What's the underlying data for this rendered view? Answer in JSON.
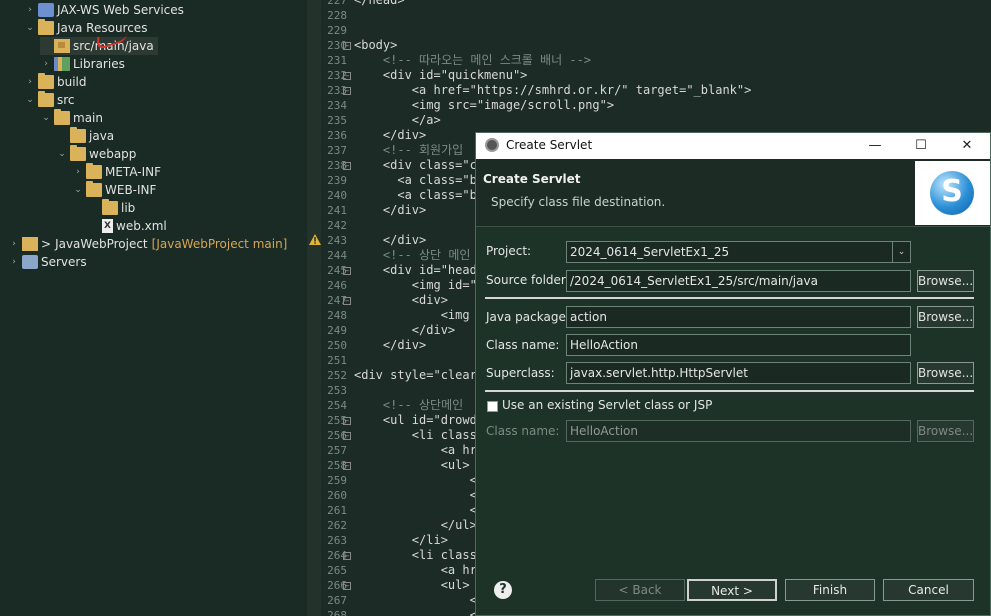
{
  "explorer": {
    "items": [
      {
        "label": "JAX-WS Web Services",
        "icon": "web-services-icon"
      },
      {
        "label": "Java Resources",
        "icon": "java-resources-icon"
      },
      {
        "label": "src/main/java",
        "icon": "source-folder-icon"
      },
      {
        "label": "Libraries",
        "icon": "libraries-icon"
      },
      {
        "label": "build",
        "icon": "folder-icon"
      },
      {
        "label": "src",
        "icon": "folder-icon"
      },
      {
        "label": "main",
        "icon": "folder-icon"
      },
      {
        "label": "java",
        "icon": "folder-icon"
      },
      {
        "label": "webapp",
        "icon": "folder-icon"
      },
      {
        "label": "META-INF",
        "icon": "folder-icon"
      },
      {
        "label": "WEB-INF",
        "icon": "folder-icon"
      },
      {
        "label": "lib",
        "icon": "folder-icon"
      },
      {
        "label": "web.xml",
        "icon": "xml-file-icon"
      },
      {
        "label": "JavaWebProject",
        "icon": "project-icon",
        "prefix": ">",
        "decoration": "[JavaWebProject main]"
      },
      {
        "label": "Servers",
        "icon": "servers-icon"
      }
    ]
  },
  "editor": {
    "lines": [
      {
        "num": "227",
        "text": "</head>"
      },
      {
        "num": "228",
        "text": ""
      },
      {
        "num": "229",
        "text": ""
      },
      {
        "num": "230",
        "text": "<body>"
      },
      {
        "num": "231",
        "text": "    <!-- 따라오는 메인 스크롤 배너 -->"
      },
      {
        "num": "232",
        "text": "    <div id=\"quickmenu\">"
      },
      {
        "num": "233",
        "text": "        <a href=\"https://smhrd.or.kr/\" target=\"_blank\">"
      },
      {
        "num": "234",
        "text": "        <img src=\"image/scroll.png\">"
      },
      {
        "num": "235",
        "text": "        </a>"
      },
      {
        "num": "236",
        "text": "    </div>"
      },
      {
        "num": "237",
        "text": "    <!-- 회원가입"
      },
      {
        "num": "238",
        "text": "    <div class=\"co"
      },
      {
        "num": "239",
        "text": "      <a class=\"b"
      },
      {
        "num": "240",
        "text": "      <a class=\"b"
      },
      {
        "num": "241",
        "text": "    </div>"
      },
      {
        "num": "242",
        "text": ""
      },
      {
        "num": "243",
        "text": "    </div>"
      },
      {
        "num": "244",
        "text": "    <!-- 상단 메인"
      },
      {
        "num": "245",
        "text": "    <div id=\"head"
      },
      {
        "num": "246",
        "text": "        <img id=\""
      },
      {
        "num": "247",
        "text": "        <div>"
      },
      {
        "num": "248",
        "text": "            <img i"
      },
      {
        "num": "249",
        "text": "        </div>"
      },
      {
        "num": "250",
        "text": "    </div>"
      },
      {
        "num": "251",
        "text": ""
      },
      {
        "num": "252",
        "text": "<div style=\"clear"
      },
      {
        "num": "253",
        "text": ""
      },
      {
        "num": "254",
        "text": "    <!-- 상단메인"
      },
      {
        "num": "255",
        "text": "    <ul id=\"drowdo"
      },
      {
        "num": "256",
        "text": "        <li class="
      },
      {
        "num": "257",
        "text": "            <a hre"
      },
      {
        "num": "258",
        "text": "            <ul>"
      },
      {
        "num": "259",
        "text": "                <"
      },
      {
        "num": "260",
        "text": "                <"
      },
      {
        "num": "261",
        "text": "                <"
      },
      {
        "num": "262",
        "text": "            </ul>"
      },
      {
        "num": "263",
        "text": "        </li>"
      },
      {
        "num": "264",
        "text": "        <li class="
      },
      {
        "num": "265",
        "text": "            <a hre"
      },
      {
        "num": "266",
        "text": "            <ul>"
      },
      {
        "num": "267",
        "text": "                <"
      },
      {
        "num": "268",
        "text": "                <"
      }
    ]
  },
  "dialog": {
    "title": "Create Servlet",
    "banner_title": "Create Servlet",
    "banner_subtitle": "Specify class file destination.",
    "logo_letter": "S",
    "project_label": "Project:",
    "project_value": "2024_0614_ServletEx1_25",
    "source_folder_label": "Source folder:",
    "source_folder_value": "/2024_0614_ServletEx1_25/src/main/java",
    "java_package_label": "Java package:",
    "java_package_value": "action",
    "class_name_label": "Class name:",
    "class_name_value": "HelloAction",
    "superclass_label": "Superclass:",
    "superclass_value": "javax.servlet.http.HttpServlet",
    "existing_checkbox_label": "Use an existing Servlet class or JSP",
    "existing_class_label": "Class name:",
    "existing_class_value": "HelloAction",
    "browse_label": "Browse...",
    "help_icon": "?",
    "back_label": "< Back",
    "next_label": "Next >",
    "finish_label": "Finish",
    "cancel_label": "Cancel",
    "minimize_glyph": "—",
    "maximize_glyph": "☐",
    "close_glyph": "✕"
  }
}
